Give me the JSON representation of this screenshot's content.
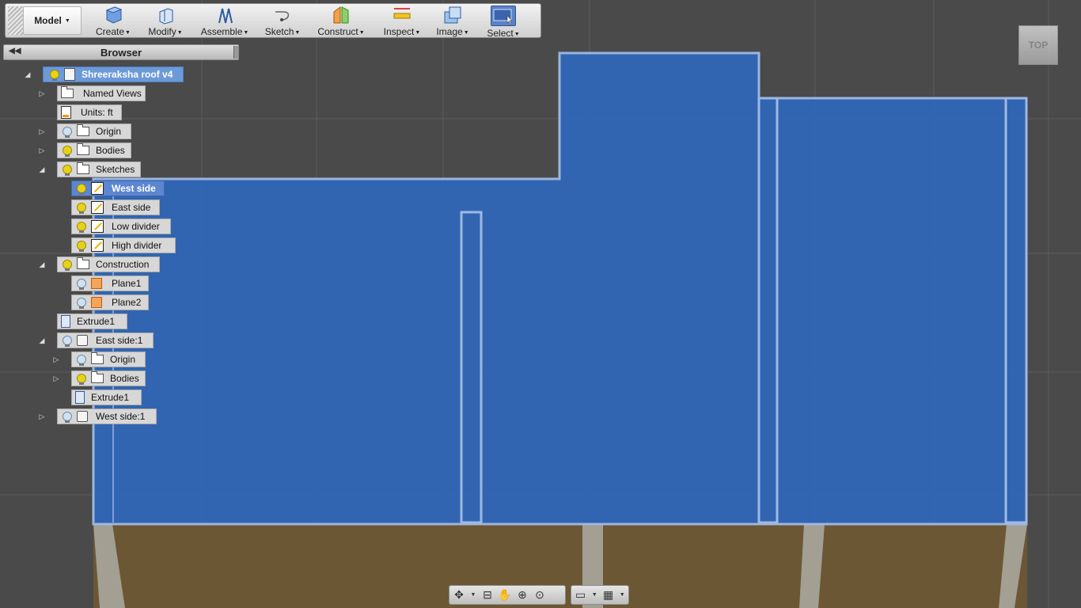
{
  "toolbar": {
    "model_label": "Model",
    "buttons": [
      {
        "id": "create",
        "label": "Create",
        "icon": "box-icon"
      },
      {
        "id": "modify",
        "label": "Modify",
        "icon": "press-pull-icon"
      },
      {
        "id": "assemble",
        "label": "Assemble",
        "icon": "joint-icon"
      },
      {
        "id": "sketch",
        "label": "Sketch",
        "icon": "sketch-curve-icon"
      },
      {
        "id": "construct",
        "label": "Construct",
        "icon": "plane-icon"
      },
      {
        "id": "inspect",
        "label": "Inspect",
        "icon": "measure-icon"
      },
      {
        "id": "image",
        "label": "Image",
        "icon": "render-icon"
      },
      {
        "id": "select",
        "label": "Select",
        "icon": "select-window-icon"
      }
    ]
  },
  "viewcube": {
    "face_label": "TOP"
  },
  "browser": {
    "title": "Browser",
    "root": "Shreeraksha roof v4",
    "named_views": "Named Views",
    "units": "Units: ft",
    "origin": "Origin",
    "bodies": "Bodies",
    "sketches": "Sketches",
    "sketch_items": [
      "West side",
      "East side",
      "Low divider",
      "High divider"
    ],
    "construction": "Construction",
    "planes": [
      "Plane1",
      "Plane2"
    ],
    "extrude1": "Extrude1",
    "east_side_component": "East side:1",
    "east_origin": "Origin",
    "east_bodies": "Bodies",
    "east_extrude": "Extrude1",
    "west_side_component": "West side:1"
  },
  "colors": {
    "sketch_fill": "#3266b5",
    "sketch_outline": "#9fb9e4",
    "wall_tan": "#6b5734",
    "wall_grey": "#9a968a"
  }
}
